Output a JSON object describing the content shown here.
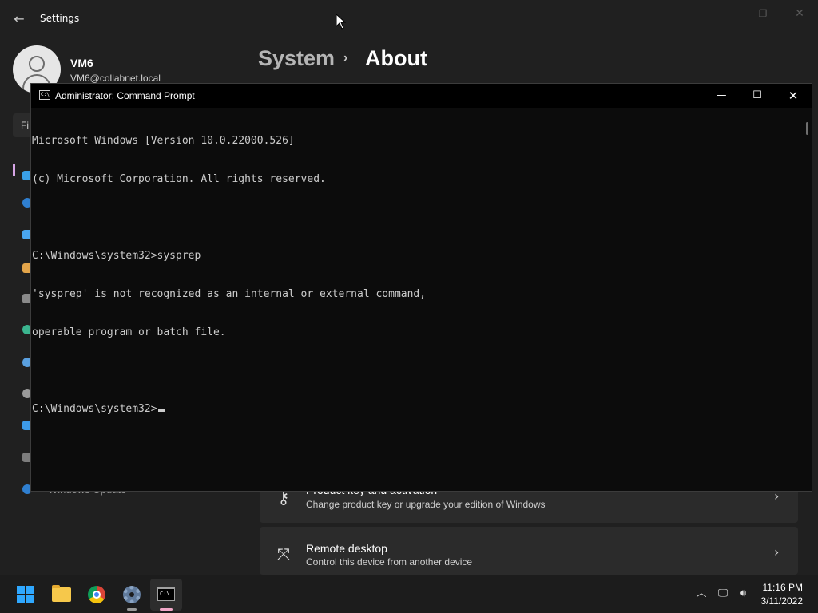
{
  "settings": {
    "title": "Settings",
    "back_icon": "back-arrow-icon",
    "profile": {
      "name": "VM6",
      "email": "VM6@collabnet.local"
    },
    "breadcrumb": {
      "parent": "System",
      "separator": "›",
      "current": "About"
    },
    "find_stub": "Fi",
    "nav_partial_label": "Windows Update",
    "cards": [
      {
        "icon": "key-icon",
        "title": "Product key and activation",
        "subtitle": "Change product key or upgrade your edition of Windows"
      },
      {
        "icon": "remote-desktop-icon",
        "title": "Remote desktop",
        "subtitle": "Control this device from another device"
      }
    ]
  },
  "cmd": {
    "title": "Administrator: Command Prompt",
    "lines": [
      "Microsoft Windows [Version 10.0.22000.526]",
      "(c) Microsoft Corporation. All rights reserved.",
      "",
      "C:\\Windows\\system32>sysprep",
      "'sysprep' is not recognized as an internal or external command,",
      "operable program or batch file.",
      "",
      "C:\\Windows\\system32>"
    ],
    "icon_text": "C:\\"
  },
  "taskbar": {
    "apps": [
      "windows-start-icon",
      "file-explorer-icon",
      "chrome-icon",
      "settings-gear-icon",
      "command-prompt-icon"
    ],
    "clock_time": "11:16 PM",
    "clock_date": "3/11/2022",
    "cmd_icon_text": "C:\\"
  },
  "colors": {
    "background": "#202020",
    "console_bg": "#0c0c0c",
    "accent": "#2fa8ff",
    "active_indicator": "#f0a7c8"
  }
}
